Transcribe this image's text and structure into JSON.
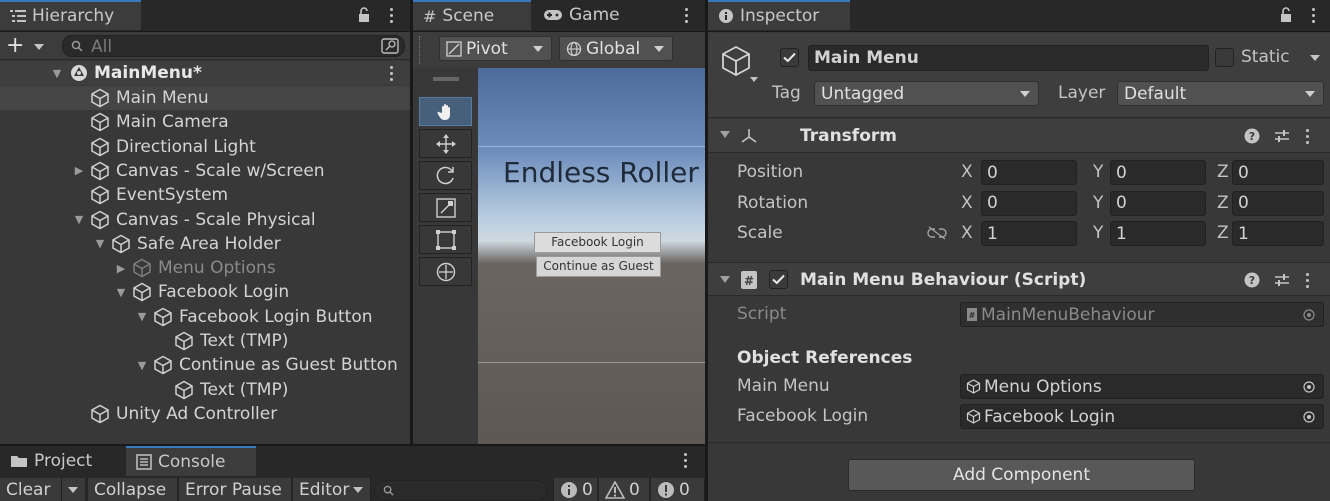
{
  "hierarchy": {
    "tab_label": "Hierarchy",
    "search_placeholder": "All",
    "scene_name": "MainMenu*",
    "items": [
      {
        "label": "Main Menu",
        "depth": 0,
        "expand": "none",
        "selected": true,
        "dim": false
      },
      {
        "label": "Main Camera",
        "depth": 0,
        "expand": "none",
        "selected": false,
        "dim": false
      },
      {
        "label": "Directional Light",
        "depth": 0,
        "expand": "none",
        "selected": false,
        "dim": false
      },
      {
        "label": "Canvas - Scale w/Screen",
        "depth": 0,
        "expand": "collapsed",
        "selected": false,
        "dim": false
      },
      {
        "label": "EventSystem",
        "depth": 0,
        "expand": "none",
        "selected": false,
        "dim": false
      },
      {
        "label": "Canvas - Scale Physical",
        "depth": 0,
        "expand": "expanded",
        "selected": false,
        "dim": false
      },
      {
        "label": "Safe Area Holder",
        "depth": 1,
        "expand": "expanded",
        "selected": false,
        "dim": false
      },
      {
        "label": "Menu Options",
        "depth": 2,
        "expand": "collapsed",
        "selected": false,
        "dim": true
      },
      {
        "label": "Facebook Login",
        "depth": 2,
        "expand": "expanded",
        "selected": false,
        "dim": false
      },
      {
        "label": "Facebook Login Button",
        "depth": 3,
        "expand": "expanded",
        "selected": false,
        "dim": false
      },
      {
        "label": "Text (TMP)",
        "depth": 4,
        "expand": "none",
        "selected": false,
        "dim": false
      },
      {
        "label": "Continue as Guest Button",
        "depth": 3,
        "expand": "expanded",
        "selected": false,
        "dim": false
      },
      {
        "label": "Text (TMP)",
        "depth": 4,
        "expand": "none",
        "selected": false,
        "dim": false
      },
      {
        "label": "Unity Ad Controller",
        "depth": 0,
        "expand": "none",
        "selected": false,
        "dim": false
      }
    ]
  },
  "scene": {
    "tabs": [
      "Scene",
      "Game"
    ],
    "pivot_label": "Pivot",
    "global_label": "Global",
    "title_text": "Endless Roller",
    "btn_facebook": "Facebook Login",
    "btn_guest": "Continue as Guest"
  },
  "inspector": {
    "tab_label": "Inspector",
    "object_name": "Main Menu",
    "static_label": "Static",
    "tag_label": "Tag",
    "tag_value": "Untagged",
    "layer_label": "Layer",
    "layer_value": "Default",
    "transform": {
      "title": "Transform",
      "rows": [
        {
          "label": "Position",
          "x": "0",
          "y": "0",
          "z": "0"
        },
        {
          "label": "Rotation",
          "x": "0",
          "y": "0",
          "z": "0"
        },
        {
          "label": "Scale",
          "x": "1",
          "y": "1",
          "z": "1"
        }
      ],
      "axis": {
        "x": "X",
        "y": "Y",
        "z": "Z"
      }
    },
    "script_component": {
      "title": "Main Menu Behaviour (Script)",
      "script_label": "Script",
      "script_value": "MainMenuBehaviour",
      "section_header": "Object References",
      "main_menu_label": "Main Menu",
      "main_menu_value": "Menu Options",
      "facebook_label": "Facebook Login",
      "facebook_value": "Facebook Login"
    },
    "add_component_label": "Add Component"
  },
  "bottom": {
    "tabs": [
      "Project",
      "Console"
    ],
    "toolbar": {
      "clear": "Clear",
      "collapse": "Collapse",
      "error_pause": "Error Pause",
      "editor": "Editor",
      "info_count": "0",
      "warn_count": "0",
      "error_count": "0"
    }
  },
  "colors": {
    "accent": "#3a79bb",
    "panel": "#383838",
    "selected_row": "#454545",
    "field_bg": "#2a2a2a"
  }
}
